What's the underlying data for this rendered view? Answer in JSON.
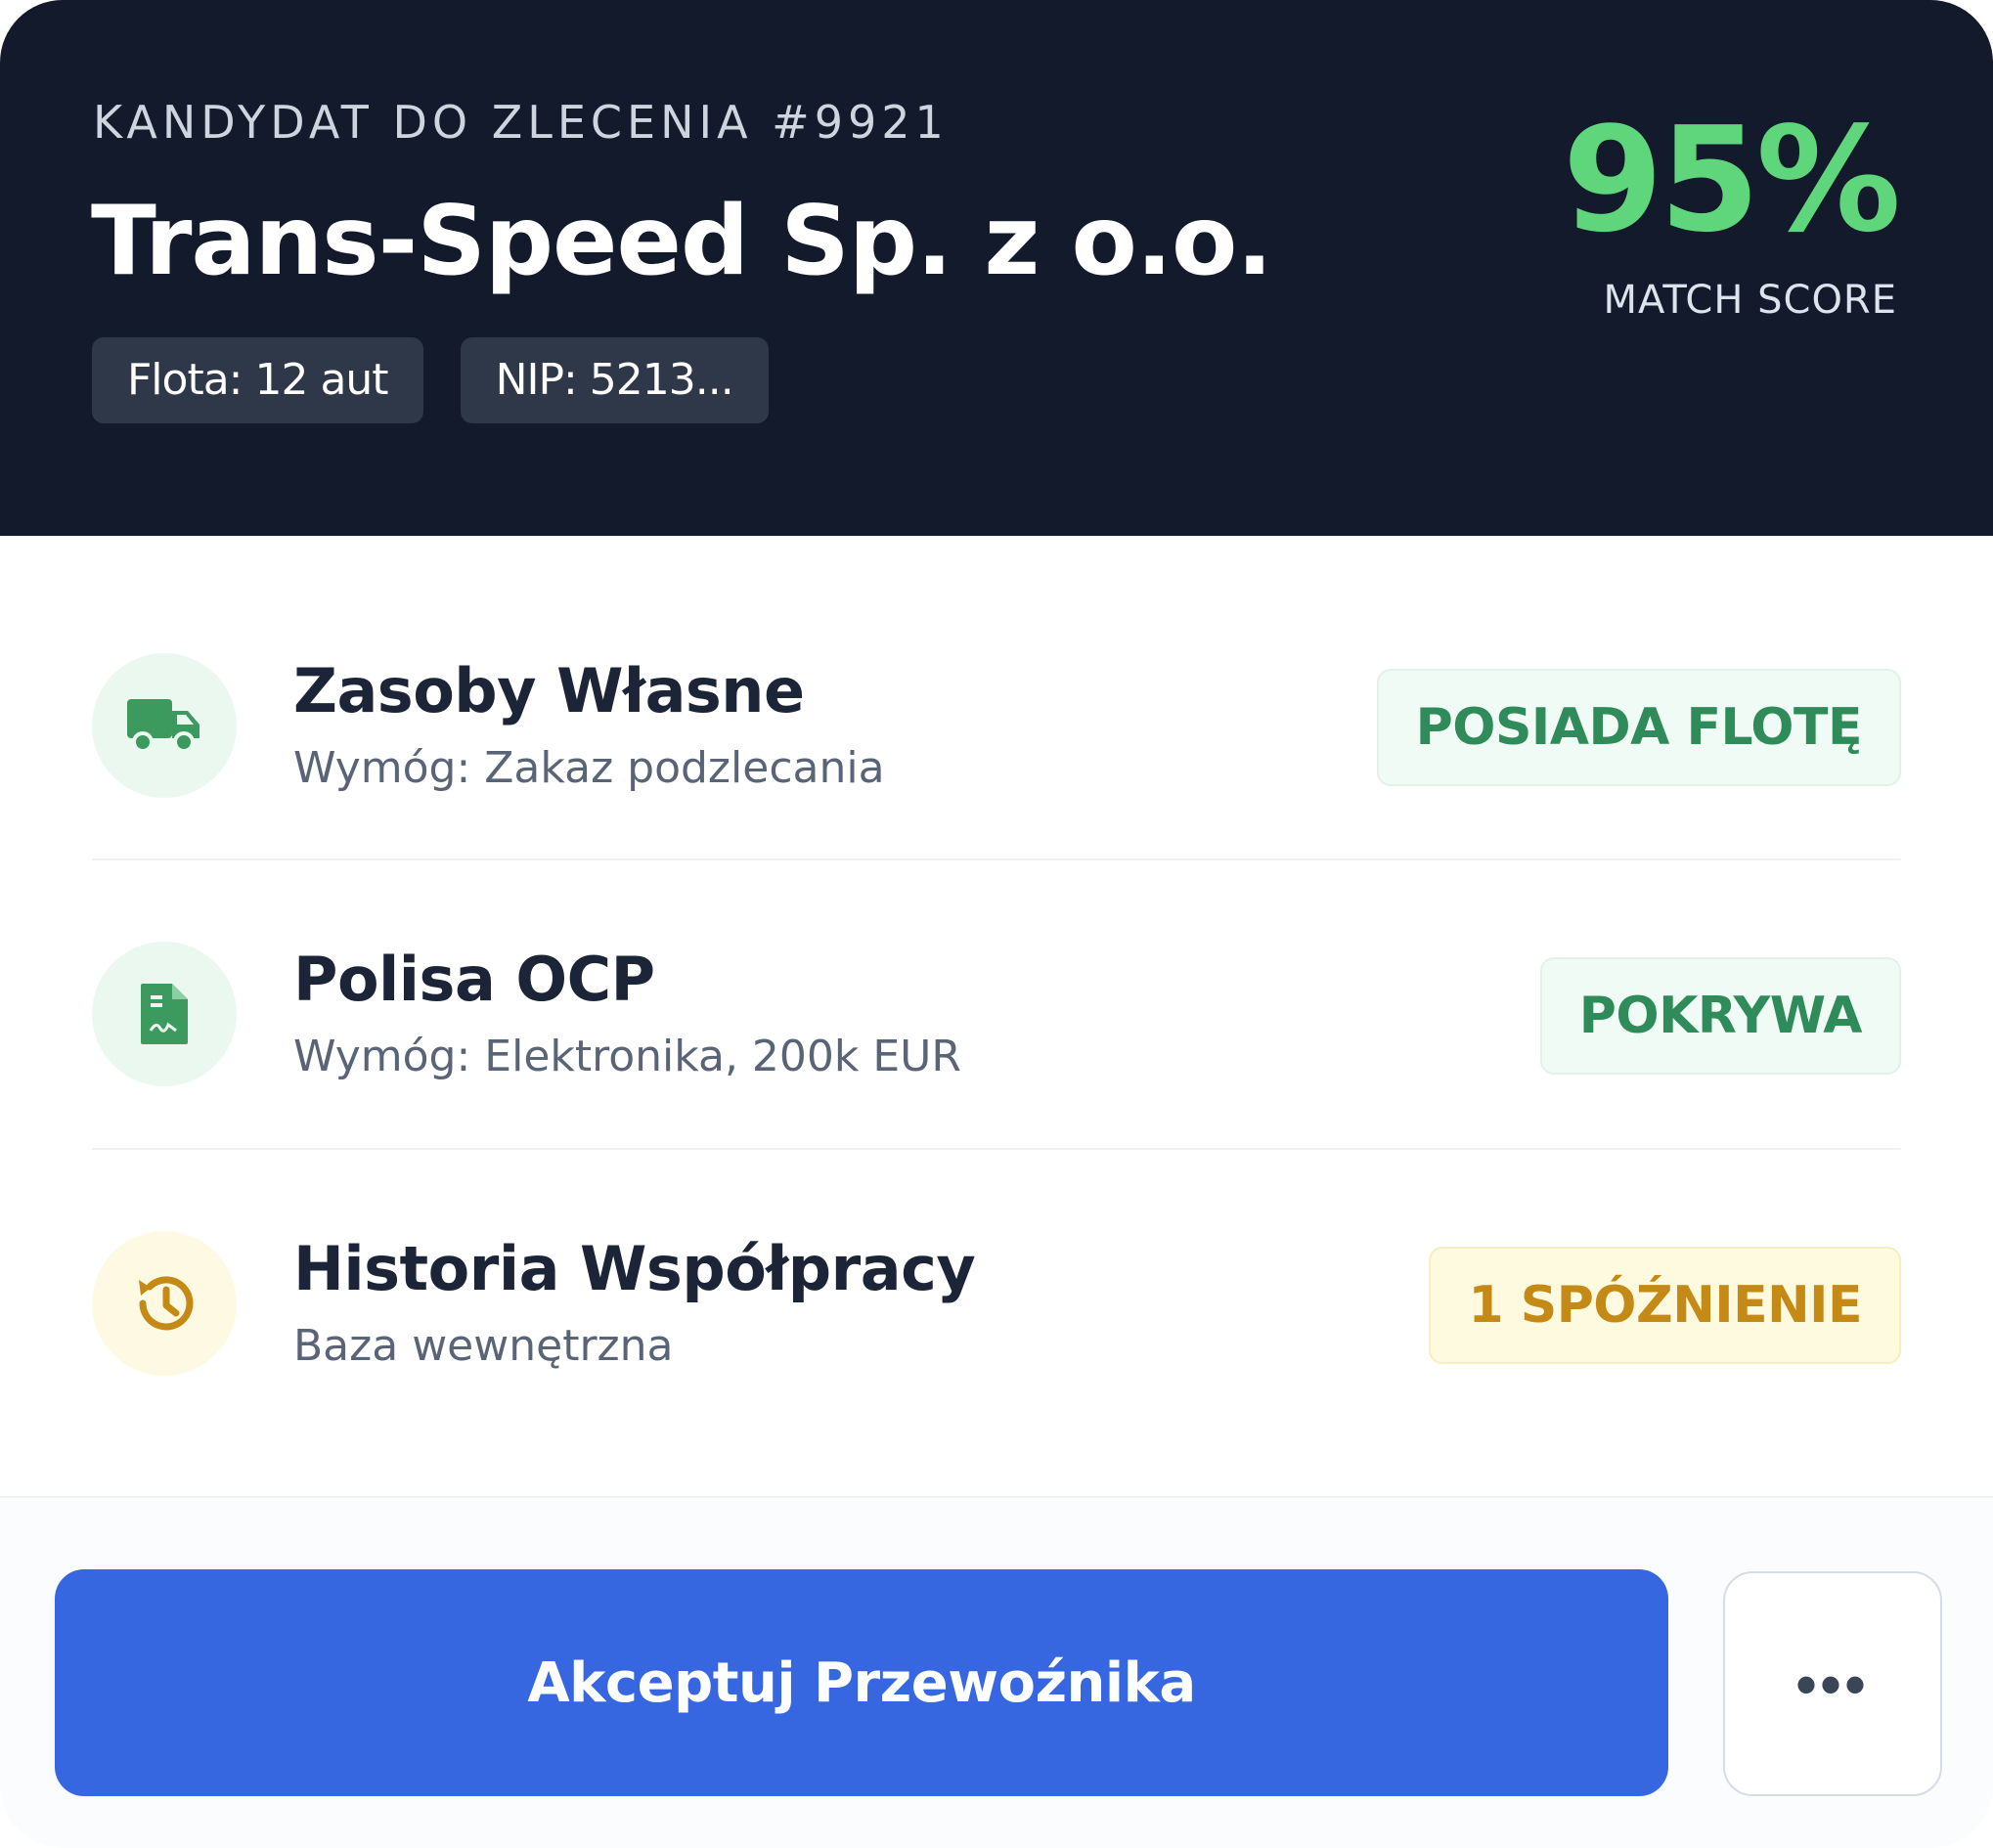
{
  "header": {
    "eyebrow": "KANDYDAT DO ZLECENIA #9921",
    "company": "Trans-Speed Sp. z o.o.",
    "chips": [
      "Flota: 12 aut",
      "NIP: 5213..."
    ],
    "score": "95%",
    "score_label": "MATCH SCORE"
  },
  "rows": [
    {
      "title": "Zasoby Własne",
      "subtitle": "Wymóg: Zakaz podzlecania",
      "badge": "POSIADA FLOTĘ",
      "icon": "truck-icon"
    },
    {
      "title": "Polisa OCP",
      "subtitle": "Wymóg: Elektronika, 200k EUR",
      "badge": "POKRYWA",
      "icon": "document-icon"
    },
    {
      "title": "Historia Współpracy",
      "subtitle": "Baza wewnętrzna",
      "badge": "1 SPÓŹNIENIE",
      "icon": "history-icon"
    }
  ],
  "actions": {
    "accept_label": "Akceptuj Przewoźnika",
    "more_label": "•••"
  },
  "colors": {
    "header_bg": "#121a2b",
    "score_green": "#5fd67c",
    "ok_green": "#2f8b59",
    "warn_yellow": "#c58a16",
    "primary_blue": "#3666e0"
  }
}
